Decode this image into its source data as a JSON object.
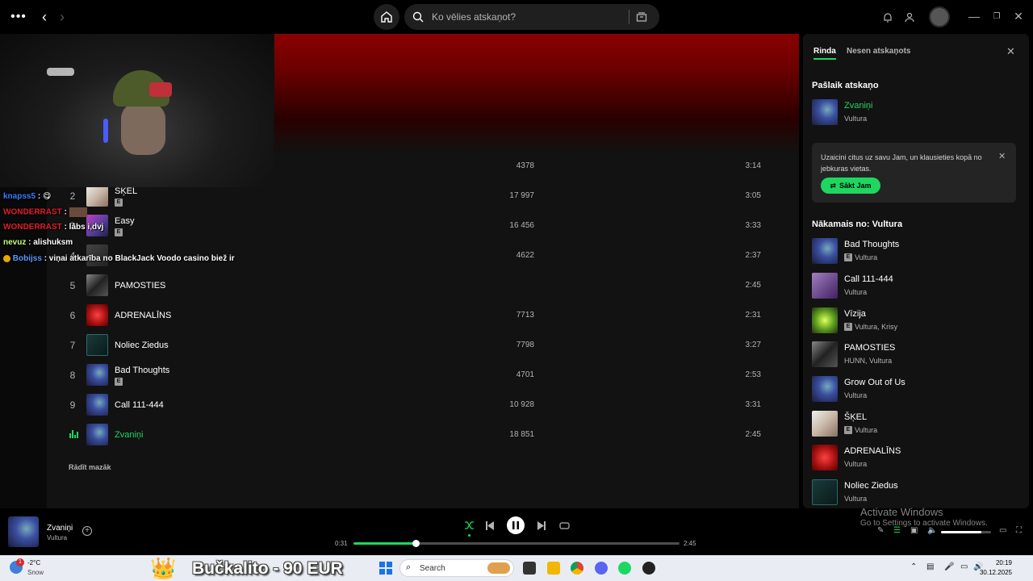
{
  "topbar": {
    "search_placeholder": "Ko vēlies atskaņot?"
  },
  "tracks": [
    {
      "num": "",
      "title": "",
      "explicit": false,
      "plays": "4378",
      "duration": "3:14"
    },
    {
      "num": "2",
      "title": "ŠĶEL",
      "explicit": true,
      "plays": "17 997",
      "duration": "3:05"
    },
    {
      "num": "3",
      "title": "Easy",
      "explicit": true,
      "plays": "16 456",
      "duration": "3:33"
    },
    {
      "num": "4",
      "title": "",
      "explicit": false,
      "plays": "4622",
      "duration": "2:37"
    },
    {
      "num": "5",
      "title": "PAMOSTIES",
      "explicit": false,
      "plays": "",
      "duration": "2:45"
    },
    {
      "num": "6",
      "title": "ADRENALĪNS",
      "explicit": false,
      "plays": "7713",
      "duration": "2:31"
    },
    {
      "num": "7",
      "title": "Noliec Ziedus",
      "explicit": false,
      "plays": "7798",
      "duration": "3:27"
    },
    {
      "num": "8",
      "title": "Bad Thoughts",
      "explicit": true,
      "plays": "4701",
      "duration": "2:53"
    },
    {
      "num": "9",
      "title": "Call 111-444",
      "explicit": false,
      "plays": "10 928",
      "duration": "3:31"
    },
    {
      "num": "",
      "title": "Zvaniņi",
      "explicit": false,
      "plays": "18 851",
      "duration": "2:45"
    }
  ],
  "show_less": "Rādīt mazāk",
  "explicit_badge": "E",
  "chat": [
    {
      "user": "knapss5",
      "msg": ":",
      "color": "#3a7bff"
    },
    {
      "user": "WONDERRAST",
      "msg": ":",
      "color": "#e0202a"
    },
    {
      "user": "WONDERRAST",
      "msg": ": lābs i,dvj",
      "color": "#e0202a"
    },
    {
      "user": "nevuz",
      "msg": ": alishuksm",
      "color": "#c8ff7a"
    },
    {
      "user": "Bobijss",
      "msg": ": viņai atkarība no BlackJack Voodo casino biež ir",
      "color": "#5a9aff"
    }
  ],
  "queue": {
    "tab_queue": "Rinda",
    "tab_recent": "Nesen atskaņots",
    "now_playing_heading": "Pašlaik atskaņo",
    "now_playing": {
      "title": "Zvaniņi",
      "artist": "Vultura"
    },
    "jam_text": "Uzaicini citus uz savu Jam, un klausieties kopā no jebkuras vietas.",
    "jam_button": "Sākt Jam",
    "next_heading": "Nākamais no: Vultura",
    "next": [
      {
        "title": "Bad Thoughts",
        "artist": "Vultura",
        "explicit": true
      },
      {
        "title": "Call 111-444",
        "artist": "Vultura",
        "explicit": false
      },
      {
        "title": "Vīzija",
        "artist": "Vultura, Krisy",
        "explicit": true
      },
      {
        "title": "PAMOSTIES",
        "artist": "HUNN, Vultura",
        "explicit": false
      },
      {
        "title": "Grow Out of Us",
        "artist": "Vultura",
        "explicit": false
      },
      {
        "title": "ŠĶEL",
        "artist": "Vultura",
        "explicit": true
      },
      {
        "title": "ADRENALĪNS",
        "artist": "Vultura",
        "explicit": false
      },
      {
        "title": "Noliec Ziedus",
        "artist": "Vultura",
        "explicit": false
      }
    ]
  },
  "player": {
    "title": "Zvaniņi",
    "artist": "Vultura",
    "time_current": "0:31",
    "time_total": "2:45",
    "progress": 0.19,
    "volume": 0.8
  },
  "watermark": {
    "line1": "Activate Windows",
    "line2": "Go to Settings to activate Windows."
  },
  "taskbar": {
    "weather_badge": "1",
    "temp": "-2°C",
    "weather": "Snow",
    "promo": "Bučkalito - 90 EUR",
    "search": "Search",
    "time": "20:19",
    "date": "30.12.2025"
  },
  "colors": {
    "accent": "#1ed760",
    "background": "#121212"
  }
}
